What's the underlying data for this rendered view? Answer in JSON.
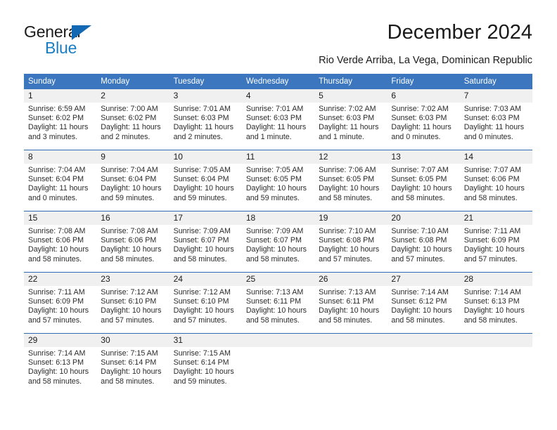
{
  "brand": {
    "name_top": "General",
    "name_bottom": "Blue",
    "accent_color": "#1368b3",
    "blue_text_color": "#1a7dc4"
  },
  "header": {
    "title": "December 2024",
    "subtitle": "Rio Verde Arriba, La Vega, Dominican Republic"
  },
  "calendar": {
    "header_bg": "#3b76be",
    "row_separator_color": "#2d6cb3",
    "daynum_bg": "#f0f0f0",
    "weekday_headers": [
      "Sunday",
      "Monday",
      "Tuesday",
      "Wednesday",
      "Thursday",
      "Friday",
      "Saturday"
    ],
    "weeks": [
      [
        {
          "day": "1",
          "sunrise": "Sunrise: 6:59 AM",
          "sunset": "Sunset: 6:02 PM",
          "daylight_1": "Daylight: 11 hours",
          "daylight_2": "and 3 minutes."
        },
        {
          "day": "2",
          "sunrise": "Sunrise: 7:00 AM",
          "sunset": "Sunset: 6:02 PM",
          "daylight_1": "Daylight: 11 hours",
          "daylight_2": "and 2 minutes."
        },
        {
          "day": "3",
          "sunrise": "Sunrise: 7:01 AM",
          "sunset": "Sunset: 6:03 PM",
          "daylight_1": "Daylight: 11 hours",
          "daylight_2": "and 2 minutes."
        },
        {
          "day": "4",
          "sunrise": "Sunrise: 7:01 AM",
          "sunset": "Sunset: 6:03 PM",
          "daylight_1": "Daylight: 11 hours",
          "daylight_2": "and 1 minute."
        },
        {
          "day": "5",
          "sunrise": "Sunrise: 7:02 AM",
          "sunset": "Sunset: 6:03 PM",
          "daylight_1": "Daylight: 11 hours",
          "daylight_2": "and 1 minute."
        },
        {
          "day": "6",
          "sunrise": "Sunrise: 7:02 AM",
          "sunset": "Sunset: 6:03 PM",
          "daylight_1": "Daylight: 11 hours",
          "daylight_2": "and 0 minutes."
        },
        {
          "day": "7",
          "sunrise": "Sunrise: 7:03 AM",
          "sunset": "Sunset: 6:03 PM",
          "daylight_1": "Daylight: 11 hours",
          "daylight_2": "and 0 minutes."
        }
      ],
      [
        {
          "day": "8",
          "sunrise": "Sunrise: 7:04 AM",
          "sunset": "Sunset: 6:04 PM",
          "daylight_1": "Daylight: 11 hours",
          "daylight_2": "and 0 minutes."
        },
        {
          "day": "9",
          "sunrise": "Sunrise: 7:04 AM",
          "sunset": "Sunset: 6:04 PM",
          "daylight_1": "Daylight: 10 hours",
          "daylight_2": "and 59 minutes."
        },
        {
          "day": "10",
          "sunrise": "Sunrise: 7:05 AM",
          "sunset": "Sunset: 6:04 PM",
          "daylight_1": "Daylight: 10 hours",
          "daylight_2": "and 59 minutes."
        },
        {
          "day": "11",
          "sunrise": "Sunrise: 7:05 AM",
          "sunset": "Sunset: 6:05 PM",
          "daylight_1": "Daylight: 10 hours",
          "daylight_2": "and 59 minutes."
        },
        {
          "day": "12",
          "sunrise": "Sunrise: 7:06 AM",
          "sunset": "Sunset: 6:05 PM",
          "daylight_1": "Daylight: 10 hours",
          "daylight_2": "and 58 minutes."
        },
        {
          "day": "13",
          "sunrise": "Sunrise: 7:07 AM",
          "sunset": "Sunset: 6:05 PM",
          "daylight_1": "Daylight: 10 hours",
          "daylight_2": "and 58 minutes."
        },
        {
          "day": "14",
          "sunrise": "Sunrise: 7:07 AM",
          "sunset": "Sunset: 6:06 PM",
          "daylight_1": "Daylight: 10 hours",
          "daylight_2": "and 58 minutes."
        }
      ],
      [
        {
          "day": "15",
          "sunrise": "Sunrise: 7:08 AM",
          "sunset": "Sunset: 6:06 PM",
          "daylight_1": "Daylight: 10 hours",
          "daylight_2": "and 58 minutes."
        },
        {
          "day": "16",
          "sunrise": "Sunrise: 7:08 AM",
          "sunset": "Sunset: 6:06 PM",
          "daylight_1": "Daylight: 10 hours",
          "daylight_2": "and 58 minutes."
        },
        {
          "day": "17",
          "sunrise": "Sunrise: 7:09 AM",
          "sunset": "Sunset: 6:07 PM",
          "daylight_1": "Daylight: 10 hours",
          "daylight_2": "and 58 minutes."
        },
        {
          "day": "18",
          "sunrise": "Sunrise: 7:09 AM",
          "sunset": "Sunset: 6:07 PM",
          "daylight_1": "Daylight: 10 hours",
          "daylight_2": "and 58 minutes."
        },
        {
          "day": "19",
          "sunrise": "Sunrise: 7:10 AM",
          "sunset": "Sunset: 6:08 PM",
          "daylight_1": "Daylight: 10 hours",
          "daylight_2": "and 57 minutes."
        },
        {
          "day": "20",
          "sunrise": "Sunrise: 7:10 AM",
          "sunset": "Sunset: 6:08 PM",
          "daylight_1": "Daylight: 10 hours",
          "daylight_2": "and 57 minutes."
        },
        {
          "day": "21",
          "sunrise": "Sunrise: 7:11 AM",
          "sunset": "Sunset: 6:09 PM",
          "daylight_1": "Daylight: 10 hours",
          "daylight_2": "and 57 minutes."
        }
      ],
      [
        {
          "day": "22",
          "sunrise": "Sunrise: 7:11 AM",
          "sunset": "Sunset: 6:09 PM",
          "daylight_1": "Daylight: 10 hours",
          "daylight_2": "and 57 minutes."
        },
        {
          "day": "23",
          "sunrise": "Sunrise: 7:12 AM",
          "sunset": "Sunset: 6:10 PM",
          "daylight_1": "Daylight: 10 hours",
          "daylight_2": "and 57 minutes."
        },
        {
          "day": "24",
          "sunrise": "Sunrise: 7:12 AM",
          "sunset": "Sunset: 6:10 PM",
          "daylight_1": "Daylight: 10 hours",
          "daylight_2": "and 57 minutes."
        },
        {
          "day": "25",
          "sunrise": "Sunrise: 7:13 AM",
          "sunset": "Sunset: 6:11 PM",
          "daylight_1": "Daylight: 10 hours",
          "daylight_2": "and 58 minutes."
        },
        {
          "day": "26",
          "sunrise": "Sunrise: 7:13 AM",
          "sunset": "Sunset: 6:11 PM",
          "daylight_1": "Daylight: 10 hours",
          "daylight_2": "and 58 minutes."
        },
        {
          "day": "27",
          "sunrise": "Sunrise: 7:14 AM",
          "sunset": "Sunset: 6:12 PM",
          "daylight_1": "Daylight: 10 hours",
          "daylight_2": "and 58 minutes."
        },
        {
          "day": "28",
          "sunrise": "Sunrise: 7:14 AM",
          "sunset": "Sunset: 6:13 PM",
          "daylight_1": "Daylight: 10 hours",
          "daylight_2": "and 58 minutes."
        }
      ],
      [
        {
          "day": "29",
          "sunrise": "Sunrise: 7:14 AM",
          "sunset": "Sunset: 6:13 PM",
          "daylight_1": "Daylight: 10 hours",
          "daylight_2": "and 58 minutes."
        },
        {
          "day": "30",
          "sunrise": "Sunrise: 7:15 AM",
          "sunset": "Sunset: 6:14 PM",
          "daylight_1": "Daylight: 10 hours",
          "daylight_2": "and 58 minutes."
        },
        {
          "day": "31",
          "sunrise": "Sunrise: 7:15 AM",
          "sunset": "Sunset: 6:14 PM",
          "daylight_1": "Daylight: 10 hours",
          "daylight_2": "and 59 minutes."
        },
        {
          "day": "",
          "sunrise": "",
          "sunset": "",
          "daylight_1": "",
          "daylight_2": ""
        },
        {
          "day": "",
          "sunrise": "",
          "sunset": "",
          "daylight_1": "",
          "daylight_2": ""
        },
        {
          "day": "",
          "sunrise": "",
          "sunset": "",
          "daylight_1": "",
          "daylight_2": ""
        },
        {
          "day": "",
          "sunrise": "",
          "sunset": "",
          "daylight_1": "",
          "daylight_2": ""
        }
      ]
    ]
  }
}
